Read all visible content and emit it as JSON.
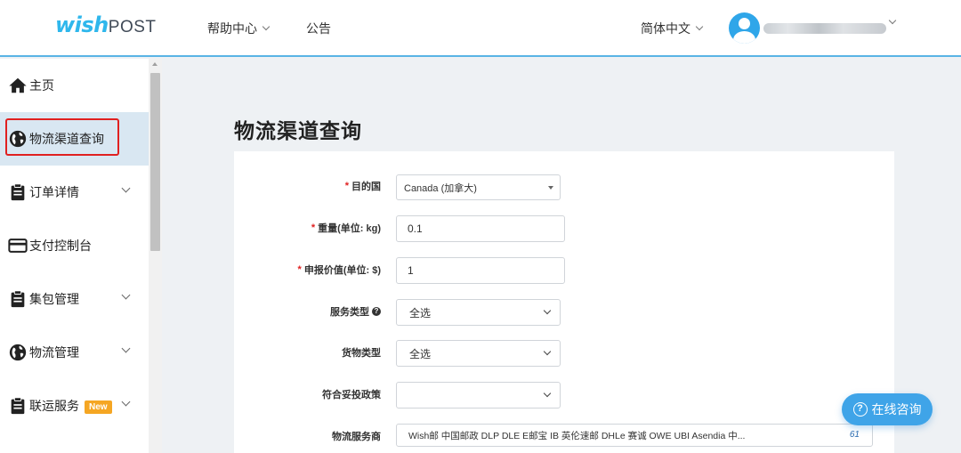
{
  "header": {
    "logo_wish": "wish",
    "logo_post": "POST",
    "nav": [
      {
        "label": "帮助中心"
      },
      {
        "label": "公告"
      }
    ],
    "language": "简体中文",
    "brand_color": "#2fb7ec"
  },
  "sidebar": {
    "items": [
      {
        "label": "主页",
        "icon": "home-icon"
      },
      {
        "label": "物流渠道查询",
        "icon": "globe-icon"
      },
      {
        "label": "订单详情",
        "icon": "clipboard-icon"
      },
      {
        "label": "支付控制台",
        "icon": "credit-card-icon"
      },
      {
        "label": "集包管理",
        "icon": "clipboard-icon"
      },
      {
        "label": "物流管理",
        "icon": "globe-icon"
      },
      {
        "label": "联运服务",
        "icon": "clipboard-icon",
        "badge": "New"
      }
    ],
    "active_color": "#d9e7f2",
    "highlight_color": "#e02020"
  },
  "main": {
    "title": "物流渠道查询",
    "form": {
      "destination_label": "目的国",
      "destination_value": "Canada (加拿大)",
      "weight_label": "重量(单位: kg)",
      "weight_value": "0.1",
      "declared_value_label": "申报价值(单位: $)",
      "declared_value_value": "1",
      "service_type_label": "服务类型",
      "service_type_value": "全选",
      "cargo_type_label": "货物类型",
      "cargo_type_value": "全选",
      "compliance_label": "符合妥投政策",
      "compliance_value": "",
      "provider_label": "物流服务商",
      "provider_value": "Wish邮 中国邮政 DLP DLE E邮宝 IB 英伦速邮 DHLe 赛诚 OWE UBI Asendia 中...",
      "provider_count": "61"
    }
  },
  "chat": {
    "label": "在线咨询",
    "color": "#3fa4e8"
  }
}
